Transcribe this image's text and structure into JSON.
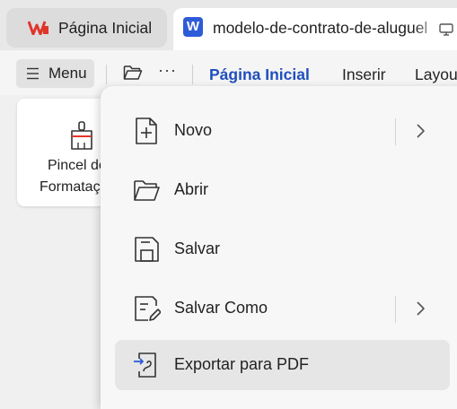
{
  "tabs": {
    "home_label": "Página Inicial",
    "doc_label": "modelo-de-contrato-de-aluguel",
    "doc_icon_letter": "W"
  },
  "toolbar": {
    "menu_label": "Menu",
    "more_label": "···",
    "ribbon_tabs": [
      "Página Inicial",
      "Inserir",
      "Layout"
    ]
  },
  "ribbon": {
    "card_line1": "Pincel de",
    "card_line2": "Formatação"
  },
  "menu": {
    "items": [
      {
        "label": "Novo",
        "icon": "new-file-icon",
        "submenu": true
      },
      {
        "label": "Abrir",
        "icon": "open-folder-icon",
        "submenu": false
      },
      {
        "label": "Salvar",
        "icon": "save-icon",
        "submenu": false
      },
      {
        "label": "Salvar Como",
        "icon": "save-as-icon",
        "submenu": true
      },
      {
        "label": "Exportar para PDF",
        "icon": "export-pdf-icon",
        "submenu": false
      }
    ]
  },
  "colors": {
    "accent": "#1f4fbd",
    "wps_red": "#e0352b",
    "doc_icon_blue": "#2e5bd7"
  }
}
